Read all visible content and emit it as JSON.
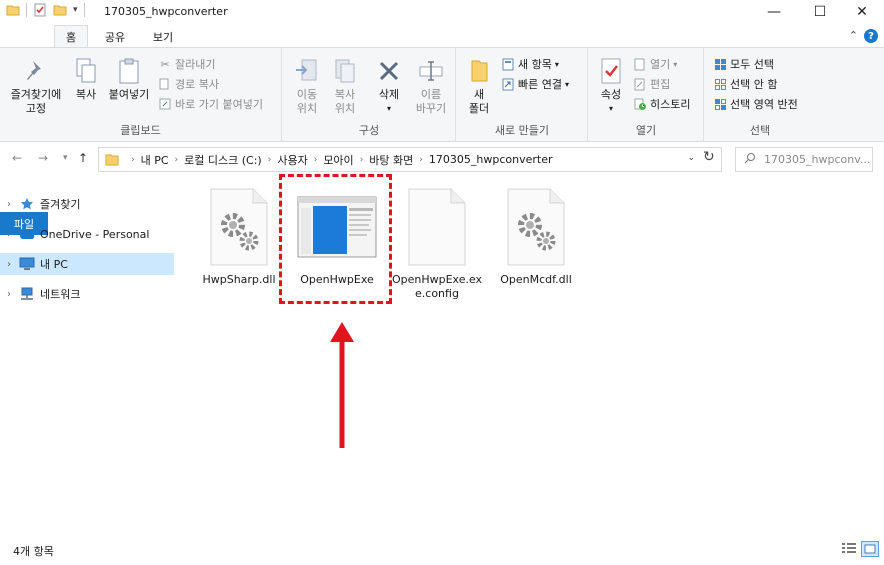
{
  "window": {
    "title": "170305_hwpconverter",
    "controls": {
      "minimize": "—",
      "maximize": "☐",
      "close": "✕"
    }
  },
  "ribbon_tabs": {
    "file": "파일",
    "home": "홈",
    "share": "공유",
    "view": "보기"
  },
  "ribbon": {
    "clipboard": {
      "pin": "즐겨찾기에\n고정",
      "copy": "복사",
      "paste": "붙여넣기",
      "cut": "잘라내기",
      "copy_path": "경로 복사",
      "paste_shortcut": "바로 가기 붙여넣기",
      "label": "클립보드"
    },
    "organize": {
      "move_to": "이동\n위치",
      "copy_to": "복사\n위치",
      "delete": "삭제",
      "rename": "이름\n바꾸기",
      "label": "구성"
    },
    "new": {
      "new_folder": "새\n폴더",
      "new_item": "새 항목",
      "easy_access": "빠른 연결",
      "label": "새로 만들기"
    },
    "open": {
      "properties": "속성",
      "open": "열기",
      "edit": "편집",
      "history": "히스토리",
      "label": "열기"
    },
    "select": {
      "select_all": "모두 선택",
      "select_none": "선택 안 함",
      "invert": "선택 영역 반전",
      "label": "선택"
    }
  },
  "address": {
    "breadcrumb": [
      "내 PC",
      "로컬 디스크 (C:)",
      "사용자",
      "모아이",
      "바탕 화면",
      "170305_hwpconverter"
    ],
    "search_placeholder": "170305_hwpconv..."
  },
  "nav_pane": [
    {
      "label": "즐겨찾기",
      "icon": "star-icon"
    },
    {
      "label": "OneDrive - Personal",
      "icon": "cloud-icon"
    },
    {
      "label": "내 PC",
      "icon": "pc-icon",
      "selected": true
    },
    {
      "label": "네트워크",
      "icon": "network-icon"
    }
  ],
  "files": [
    {
      "name": "HwpSharp.dll",
      "icon": "dll-gear-file-icon"
    },
    {
      "name": "OpenHwpExe",
      "icon": "exe-window-icon"
    },
    {
      "name": "OpenHwpExe.ex\ne.config",
      "icon": "blank-file-icon"
    },
    {
      "name": "OpenMcdf.dll",
      "icon": "dll-gear-file-icon"
    }
  ],
  "status": {
    "item_count": "4개 항목"
  },
  "colors": {
    "accent": "#1979ca",
    "annotation": "#e0151e",
    "selection": "#cce8ff"
  }
}
